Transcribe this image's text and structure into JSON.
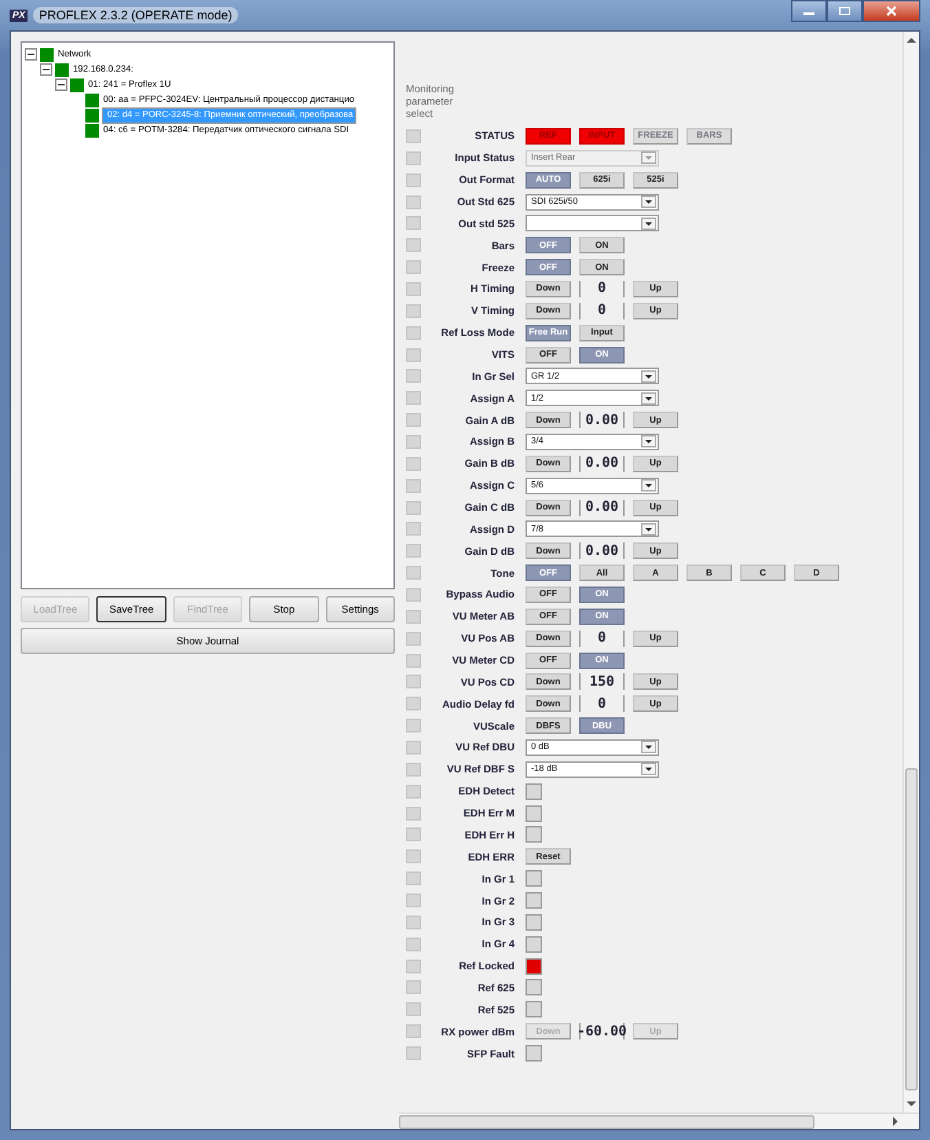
{
  "window": {
    "icon_label": "PX",
    "title": "PROFLEX 2.3.2 (OPERATE mode)"
  },
  "tree": [
    {
      "label": "Network",
      "expanded": true,
      "selected": false,
      "children": [
        {
          "label": "192.168.0.234:",
          "expanded": true,
          "selected": false,
          "children": [
            {
              "label": "01: 241 = Proflex 1U",
              "expanded": true,
              "selected": false,
              "children": [
                {
                  "label": "00: aa = PFPC-3024EV: Центральный процессор дистанцио",
                  "selected": false
                },
                {
                  "label": "02: d4 = PORC-3245-8: Приемник оптический, преобразова",
                  "selected": true
                },
                {
                  "label": "04: c6 = POTM-3284: Передатчик оптического сигнала SDI",
                  "selected": false
                }
              ]
            }
          ]
        }
      ]
    }
  ],
  "tree_buttons": [
    {
      "label": "LoadTree",
      "disabled": true,
      "focused": false
    },
    {
      "label": "SaveTree",
      "disabled": false,
      "focused": true
    },
    {
      "label": "FindTree",
      "disabled": true,
      "focused": false
    },
    {
      "label": "Stop",
      "disabled": false,
      "focused": false
    },
    {
      "label": "Settings",
      "disabled": false,
      "focused": false
    }
  ],
  "journal_button": "Show Journal",
  "monitor_header": "Monitoring parameter select",
  "params": [
    {
      "label": "STATUS",
      "kind": "status",
      "buttons": [
        {
          "label": "REF",
          "lit": true
        },
        {
          "label": "INPUT",
          "lit": true
        },
        {
          "label": "FREEZE",
          "lit": false
        },
        {
          "label": "BARS",
          "lit": false
        }
      ]
    },
    {
      "label": "Input Status",
      "kind": "select",
      "value": "Insert Rear",
      "disabled": true
    },
    {
      "label": "Out Format",
      "kind": "toggle",
      "options": [
        {
          "label": "AUTO",
          "selected": true
        },
        {
          "label": "625i",
          "selected": false
        },
        {
          "label": "525i",
          "selected": false
        }
      ]
    },
    {
      "label": "Out Std 625",
      "kind": "select",
      "value": "SDI 625i/50",
      "disabled": false
    },
    {
      "label": "Out std 525",
      "kind": "select",
      "disabled": false
    },
    {
      "label": "Bars",
      "kind": "toggle",
      "options": [
        {
          "label": "OFF",
          "selected": true
        },
        {
          "label": "ON",
          "selected": false
        }
      ]
    },
    {
      "label": "Freeze",
      "kind": "toggle",
      "options": [
        {
          "label": "OFF",
          "selected": true
        },
        {
          "label": "ON",
          "selected": false
        }
      ]
    },
    {
      "label": "H Timing",
      "kind": "stepper",
      "down": "Down",
      "value": "0",
      "up": "Up",
      "disabled": false
    },
    {
      "label": "V Timing",
      "kind": "stepper",
      "down": "Down",
      "value": "0",
      "up": "Up",
      "disabled": false
    },
    {
      "label": "Ref Loss Mode",
      "kind": "toggle",
      "options": [
        {
          "label": "Free Run",
          "selected": true
        },
        {
          "label": "Input",
          "selected": false
        }
      ]
    },
    {
      "label": "VITS",
      "kind": "toggle",
      "options": [
        {
          "label": "OFF",
          "selected": false
        },
        {
          "label": "ON",
          "selected": true
        }
      ]
    },
    {
      "label": "In Gr Sel",
      "kind": "select",
      "value": "GR 1/2",
      "disabled": false
    },
    {
      "label": "Assign A",
      "kind": "select",
      "value": "1/2",
      "disabled": false
    },
    {
      "label": "Gain A dB",
      "kind": "stepper",
      "down": "Down",
      "value": "0.00",
      "up": "Up",
      "disabled": false
    },
    {
      "label": "Assign B",
      "kind": "select",
      "value": "3/4",
      "disabled": false
    },
    {
      "label": "Gain B dB",
      "kind": "stepper",
      "down": "Down",
      "value": "0.00",
      "up": "Up",
      "disabled": false
    },
    {
      "label": "Assign C",
      "kind": "select",
      "value": "5/6",
      "disabled": false
    },
    {
      "label": "Gain C dB",
      "kind": "stepper",
      "down": "Down",
      "value": "0.00",
      "up": "Up",
      "disabled": false
    },
    {
      "label": "Assign D",
      "kind": "select",
      "value": "7/8",
      "disabled": false
    },
    {
      "label": "Gain D dB",
      "kind": "stepper",
      "down": "Down",
      "value": "0.00",
      "up": "Up",
      "disabled": false
    },
    {
      "label": "Tone",
      "kind": "toggle",
      "options": [
        {
          "label": "OFF",
          "selected": true
        },
        {
          "label": "All",
          "selected": false
        },
        {
          "label": "A",
          "selected": false
        },
        {
          "label": "B",
          "selected": false
        },
        {
          "label": "C",
          "selected": false
        },
        {
          "label": "D",
          "selected": false
        }
      ]
    },
    {
      "label": "Bypass Audio",
      "kind": "toggle",
      "options": [
        {
          "label": "OFF",
          "selected": false
        },
        {
          "label": "ON",
          "selected": true
        }
      ]
    },
    {
      "label": "VU Meter AB",
      "kind": "toggle",
      "options": [
        {
          "label": "OFF",
          "selected": false
        },
        {
          "label": "ON",
          "selected": true
        }
      ]
    },
    {
      "label": "VU Pos AB",
      "kind": "stepper",
      "down": "Down",
      "value": "0",
      "up": "Up",
      "disabled": false
    },
    {
      "label": "VU Meter CD",
      "kind": "toggle",
      "options": [
        {
          "label": "OFF",
          "selected": false
        },
        {
          "label": "ON",
          "selected": true
        }
      ]
    },
    {
      "label": "VU Pos CD",
      "kind": "stepper",
      "down": "Down",
      "value": "150",
      "up": "Up",
      "disabled": false
    },
    {
      "label": "Audio Delay fd",
      "kind": "stepper",
      "down": "Down",
      "value": "0",
      "up": "Up",
      "disabled": false
    },
    {
      "label": "VUScale",
      "kind": "toggle",
      "options": [
        {
          "label": "DBFS",
          "selected": false
        },
        {
          "label": "DBU",
          "selected": true
        }
      ]
    },
    {
      "label": "VU Ref DBU",
      "kind": "select",
      "value": "0 dB",
      "disabled": false
    },
    {
      "label": "VU Ref DBF S",
      "kind": "select",
      "value": "-18 dB",
      "disabled": false
    },
    {
      "label": "EDH Detect",
      "kind": "indicator",
      "lit": false
    },
    {
      "label": "EDH Err M",
      "kind": "indicator",
      "lit": false
    },
    {
      "label": "EDH Err H",
      "kind": "indicator",
      "lit": false
    },
    {
      "label": "EDH ERR",
      "kind": "action",
      "button": "Reset"
    },
    {
      "label": "In Gr 1",
      "kind": "indicator",
      "lit": false
    },
    {
      "label": "In Gr 2",
      "kind": "indicator",
      "lit": false
    },
    {
      "label": "In Gr 3",
      "kind": "indicator",
      "lit": false
    },
    {
      "label": "In Gr 4",
      "kind": "indicator",
      "lit": false
    },
    {
      "label": "Ref Locked",
      "kind": "indicator",
      "lit": true
    },
    {
      "label": "Ref 625",
      "kind": "indicator",
      "lit": false
    },
    {
      "label": "Ref 525",
      "kind": "indicator",
      "lit": false
    },
    {
      "label": "RX power dBm",
      "kind": "stepper",
      "down": "Down",
      "value": "-60.00",
      "up": "Up",
      "disabled": true
    },
    {
      "label": "SFP Fault",
      "kind": "indicator",
      "lit": false
    }
  ]
}
